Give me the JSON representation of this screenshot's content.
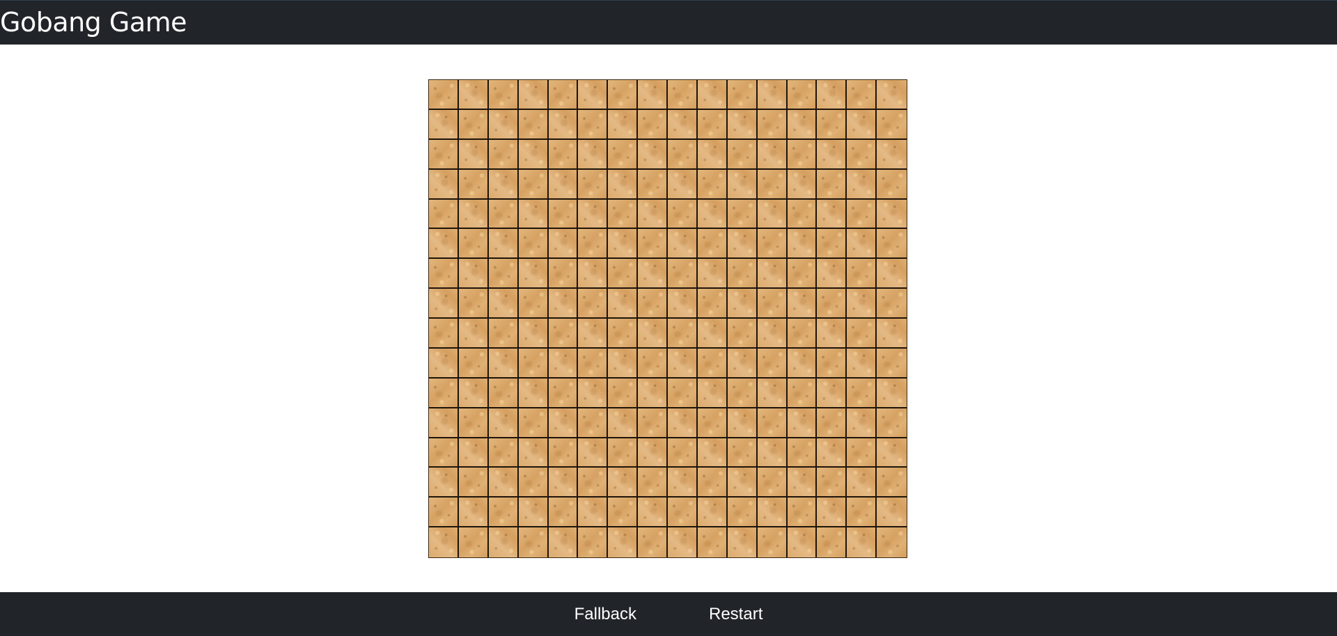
{
  "header": {
    "title": "Gobang Game"
  },
  "board": {
    "rows": 16,
    "cols": 16,
    "line_color": "#1e140a",
    "wood_color": "#dcaa6c",
    "stones": []
  },
  "footer": {
    "fallback_label": "Fallback",
    "restart_label": "Restart"
  },
  "colors": {
    "bar_background": "#212429",
    "bar_text": "#ffffff",
    "page_background": "#ffffff"
  }
}
